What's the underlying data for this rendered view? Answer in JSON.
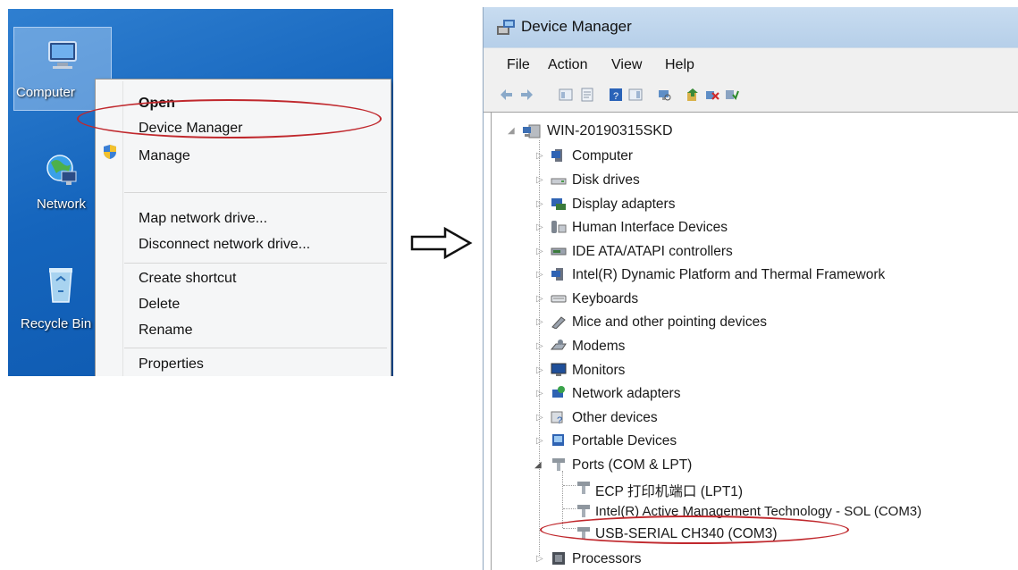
{
  "desktop": {
    "icons": [
      {
        "label": "Computer",
        "icon": "computer-icon"
      },
      {
        "label": "Network",
        "icon": "network-icon"
      },
      {
        "label": "Recycle Bin",
        "icon": "recycle-bin-icon"
      }
    ],
    "context_menu": {
      "open": "Open",
      "device_manager": "Device Manager",
      "manage": "Manage",
      "map_network_drive": "Map network drive...",
      "disconnect_network_drive": "Disconnect network drive...",
      "create_shortcut": "Create shortcut",
      "delete": "Delete",
      "rename": "Rename",
      "properties": "Properties"
    }
  },
  "device_manager": {
    "title": "Device Manager",
    "menu": [
      "File",
      "Action",
      "View",
      "Help"
    ],
    "root": "WIN-20190315SKD",
    "categories": [
      {
        "label": "Computer",
        "icon": "computer-icon"
      },
      {
        "label": "Disk drives",
        "icon": "disk-drive-icon"
      },
      {
        "label": "Display adapters",
        "icon": "display-adapter-icon"
      },
      {
        "label": "Human Interface Devices",
        "icon": "hid-icon"
      },
      {
        "label": "IDE ATA/ATAPI controllers",
        "icon": "ide-controller-icon"
      },
      {
        "label": "Intel(R) Dynamic Platform and Thermal Framework",
        "icon": "intel-icon"
      },
      {
        "label": "Keyboards",
        "icon": "keyboard-icon"
      },
      {
        "label": "Mice and other pointing devices",
        "icon": "mouse-icon"
      },
      {
        "label": "Modems",
        "icon": "modem-icon"
      },
      {
        "label": "Monitors",
        "icon": "monitor-icon"
      },
      {
        "label": "Network adapters",
        "icon": "network-adapter-icon"
      },
      {
        "label": "Other devices",
        "icon": "other-devices-icon"
      },
      {
        "label": "Portable Devices",
        "icon": "portable-device-icon"
      },
      {
        "label": "Ports (COM & LPT)",
        "icon": "port-icon"
      }
    ],
    "ports": [
      "ECP 打印机端口 (LPT1)",
      "Intel(R) Active Management Technology - SOL (COM3)",
      "USB-SERIAL CH340 (COM3)"
    ],
    "after": [
      {
        "label": "Processors",
        "icon": "processor-icon"
      }
    ]
  },
  "colors": {
    "desktop_blue": "#1565bd",
    "highlight_ellipse": "#c0282d",
    "title_bar": "#c8dcf0"
  }
}
